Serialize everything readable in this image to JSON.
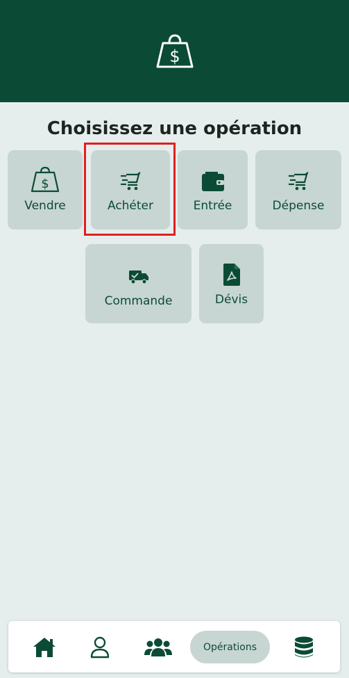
{
  "header": {
    "icon": "shopping-bag-dollar-icon",
    "background": "#0b4b35"
  },
  "title": "Choisissez une opération",
  "tiles": [
    {
      "label": "Vendre",
      "icon": "shopping-bag-dollar-icon"
    },
    {
      "label": "Achéter",
      "icon": "cart-fast-icon"
    },
    {
      "label": "Entrée",
      "icon": "wallet-icon"
    },
    {
      "label": "Dépense",
      "icon": "cart-fast-icon"
    },
    {
      "label": "Commande",
      "icon": "delivery-truck-icon"
    },
    {
      "label": "Dévis",
      "icon": "pdf-document-icon"
    }
  ],
  "bottom_nav": {
    "items": [
      {
        "icon": "home-icon"
      },
      {
        "icon": "user-icon"
      },
      {
        "icon": "users-group-icon"
      },
      {
        "label": "Opérations",
        "active": true
      },
      {
        "icon": "database-icon"
      }
    ]
  },
  "colors": {
    "accent": "#0b4b35",
    "tile_bg": "#c7d6d2",
    "page_bg": "#e6eeed",
    "highlight": "#e0201f"
  }
}
